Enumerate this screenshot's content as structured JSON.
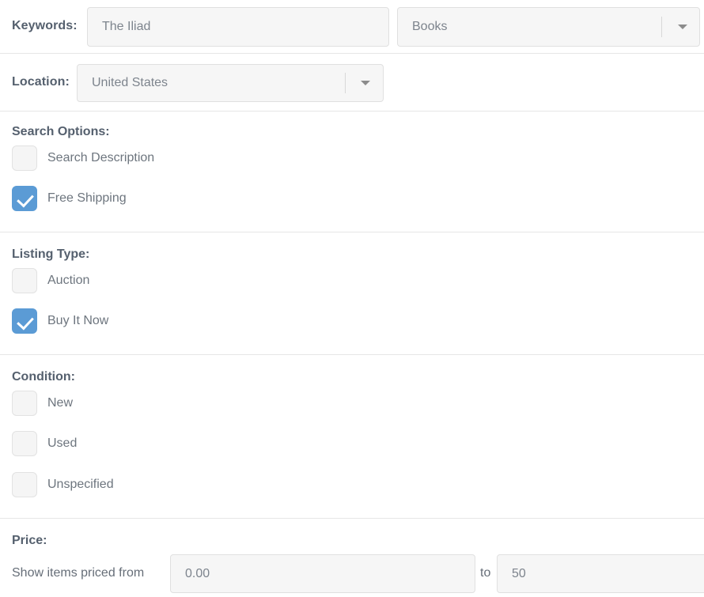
{
  "form": {
    "keywords": {
      "label": "Keywords:",
      "text_value": "The Iliad",
      "text_placeholder": "The Iliad",
      "category_value": "Books",
      "category_icon": "chevron-down-icon"
    },
    "location": {
      "label": "Location:",
      "value": "United States",
      "icon": "chevron-down-icon"
    },
    "search_options": {
      "heading": "Search Options:",
      "items": [
        {
          "label": "Search Description",
          "checked": false
        },
        {
          "label": "Free Shipping",
          "checked": true
        }
      ]
    },
    "listing_type": {
      "heading": "Listing Type:",
      "items": [
        {
          "label": "Auction",
          "checked": false
        },
        {
          "label": "Buy It Now",
          "checked": true
        }
      ]
    },
    "condition": {
      "heading": "Condition:",
      "items": [
        {
          "label": "New",
          "checked": false
        },
        {
          "label": "Used",
          "checked": false
        },
        {
          "label": "Unspecified",
          "checked": false
        }
      ]
    },
    "price": {
      "heading": "Price:",
      "from_label": "Show items priced from",
      "from_value": "0.00",
      "to_label": "to",
      "to_value": "50"
    }
  },
  "colors": {
    "accent_checked": "#5b9bd5",
    "field_background": "#f6f6f6",
    "field_border": "#e0e0e0",
    "divider": "#e6e6e6",
    "label_text": "#55606e",
    "value_text": "#7d848d"
  }
}
